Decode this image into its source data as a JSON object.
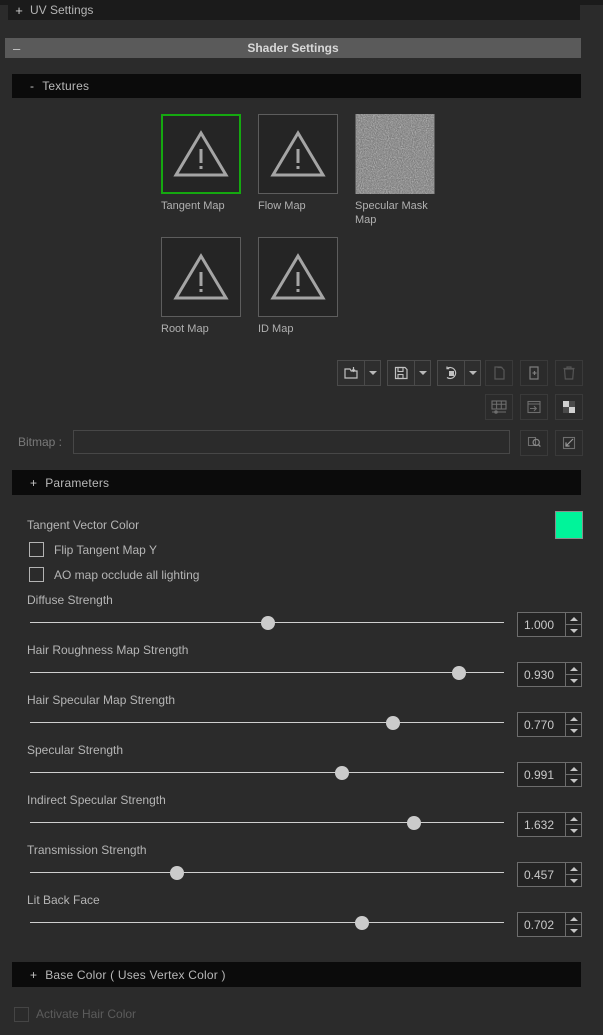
{
  "top_tab": {
    "sign": "+",
    "label": "UV Settings"
  },
  "shader_header": {
    "sign": "–",
    "title": "Shader Settings"
  },
  "sections": {
    "textures": {
      "sign": "-",
      "label": "Textures"
    },
    "parameters": {
      "sign": "+",
      "label": "Parameters"
    },
    "base_color": {
      "sign": "+",
      "label": "Base Color ( Uses Vertex Color )"
    }
  },
  "textures": {
    "row1": [
      {
        "label": "Tangent Map",
        "icon": "warning-triangle-icon",
        "selected": true
      },
      {
        "label": "Flow Map",
        "icon": "warning-triangle-icon",
        "selected": false
      },
      {
        "label": "Specular Mask Map",
        "icon": "noise-texture-preview",
        "selected": false
      }
    ],
    "row2": [
      {
        "label": "Root Map",
        "icon": "warning-triangle-icon",
        "selected": false
      },
      {
        "label": "ID Map",
        "icon": "warning-triangle-icon",
        "selected": false
      }
    ],
    "selection_color": "#15a810"
  },
  "toolbar": {
    "buttons": [
      {
        "name": "open-bitmap-button",
        "icon": "folder-open-arrow-icon",
        "enabled": true,
        "has_dropdown": true
      },
      {
        "name": "save-bitmap-button",
        "icon": "floppy-disk-icon",
        "enabled": true,
        "has_dropdown": true
      },
      {
        "name": "reload-bitmap-button",
        "icon": "refresh-circle-icon",
        "enabled": true,
        "has_dropdown": true
      },
      {
        "name": "copy-bitmap-button",
        "icon": "copy-pages-icon",
        "enabled": false,
        "has_dropdown": false
      },
      {
        "name": "paste-bitmap-button",
        "icon": "page-plus-icon",
        "enabled": false,
        "has_dropdown": false
      },
      {
        "name": "delete-bitmap-button",
        "icon": "trash-icon",
        "enabled": false,
        "has_dropdown": false
      }
    ],
    "buttons_row2": [
      {
        "name": "bitmap-grid-button",
        "icon": "grid-slider-icon",
        "enabled": false
      },
      {
        "name": "bitmap-export-button",
        "icon": "window-arrow-icon",
        "enabled": false
      },
      {
        "name": "bitmap-checker-button",
        "icon": "checkerboard-icon",
        "enabled": false
      }
    ]
  },
  "bitmap": {
    "label": "Bitmap :",
    "value": "",
    "placeholder": "",
    "browse_icon": "magnifier-page-icon",
    "pick_icon": "arrow-into-box-icon"
  },
  "parameters": {
    "tangent_vector_color": {
      "label": "Tangent Vector Color",
      "color": "#00f49a"
    },
    "checkboxes": [
      {
        "label": "Flip Tangent Map Y",
        "checked": false
      },
      {
        "label": "AO map occlude all lighting",
        "checked": false
      }
    ],
    "sliders": [
      {
        "label": "Diffuse Strength",
        "value": "1.000",
        "fraction": 0.502
      },
      {
        "label": "Hair Roughness Map Strength",
        "value": "0.930",
        "fraction": 0.905
      },
      {
        "label": "Hair Specular Map Strength",
        "value": "0.770",
        "fraction": 0.766
      },
      {
        "label": "Specular Strength",
        "value": "0.991",
        "fraction": 0.658
      },
      {
        "label": "Indirect Specular Strength",
        "value": "1.632",
        "fraction": 0.81
      },
      {
        "label": "Transmission Strength",
        "value": "0.457",
        "fraction": 0.31
      },
      {
        "label": "Lit Back Face",
        "value": "0.702",
        "fraction": 0.7
      }
    ]
  },
  "bottom": {
    "checkbox_label": "Activate Hair Color",
    "checked": false,
    "disabled": true
  }
}
